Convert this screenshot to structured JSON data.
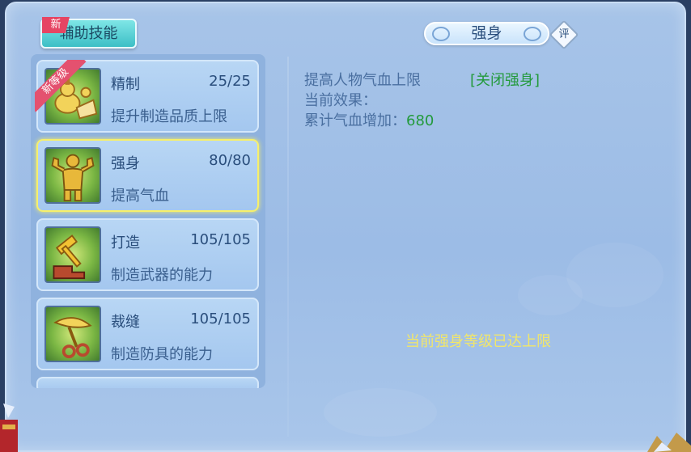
{
  "tab": {
    "label": "辅助技能",
    "badge": "新"
  },
  "skills": [
    {
      "name": "精制",
      "level": "25/25",
      "desc": "提升制造品质上限",
      "ribbon": "新等级",
      "icon": "gourd-icon"
    },
    {
      "name": "强身",
      "level": "80/80",
      "desc": "提高气血",
      "icon": "muscle-man-icon"
    },
    {
      "name": "打造",
      "level": "105/105",
      "desc": "制造武器的能力",
      "icon": "hammer-anvil-icon"
    },
    {
      "name": "裁缝",
      "level": "105/105",
      "desc": "制造防具的能力",
      "icon": "scissors-icon"
    }
  ],
  "selected_index": 1,
  "detail": {
    "title": "强身",
    "rate_label": "评",
    "line1": "提高人物气血上限",
    "close_link": "[关闭强身]",
    "line2": "当前效果：",
    "line3_label": "累计气血增加：",
    "line3_value": "680",
    "max_note": "当前强身等级已达上限"
  },
  "colors": {
    "panel_bg": "#9cbce6",
    "highlight": "#f7f06a",
    "green_text": "#239a3c",
    "badge": "#e64563",
    "tab": "#3dbfc6"
  }
}
